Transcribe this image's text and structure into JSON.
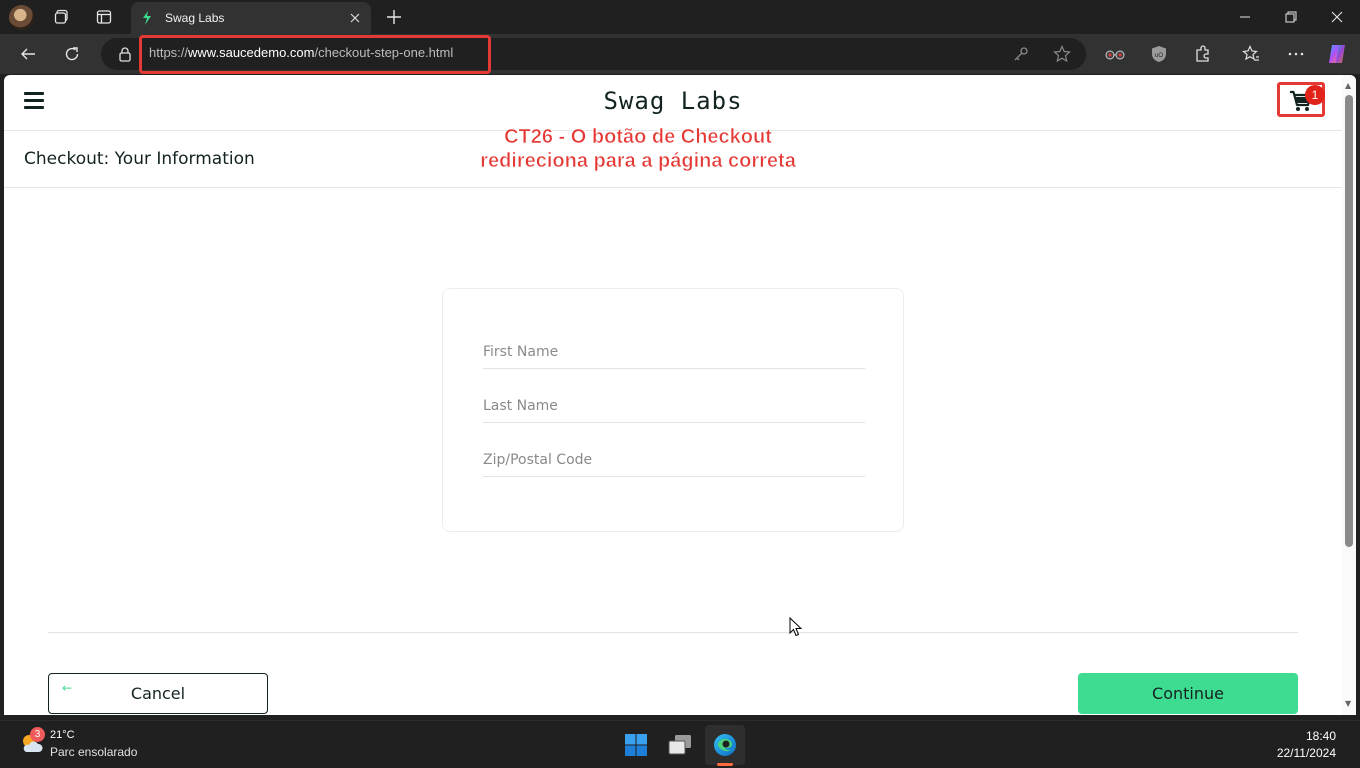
{
  "browser": {
    "tab_title": "Swag Labs",
    "url_prefix": "https://",
    "url_host": "www.saucedemo.com",
    "url_path": "/checkout-step-one.html"
  },
  "page": {
    "logo": "Swag Labs",
    "cart_count": "1",
    "title": "Checkout: Your Information",
    "annotation_line1": "CT26 - O botão de Checkout",
    "annotation_line2": "redireciona para a página correta",
    "form": {
      "first_name_placeholder": "First Name",
      "last_name_placeholder": "Last Name",
      "zip_placeholder": "Zip/Postal Code"
    },
    "cancel_label": "Cancel",
    "continue_label": "Continue"
  },
  "taskbar": {
    "weather_badge": "3",
    "weather_temp": "21°C",
    "weather_desc": "Parc ensolarado",
    "time": "18:40",
    "date": "22/11/2024"
  },
  "colors": {
    "accent_green": "#3ddc91",
    "highlight_red": "#e53935",
    "text_dark": "#132322",
    "badge_red": "#e2231a"
  }
}
